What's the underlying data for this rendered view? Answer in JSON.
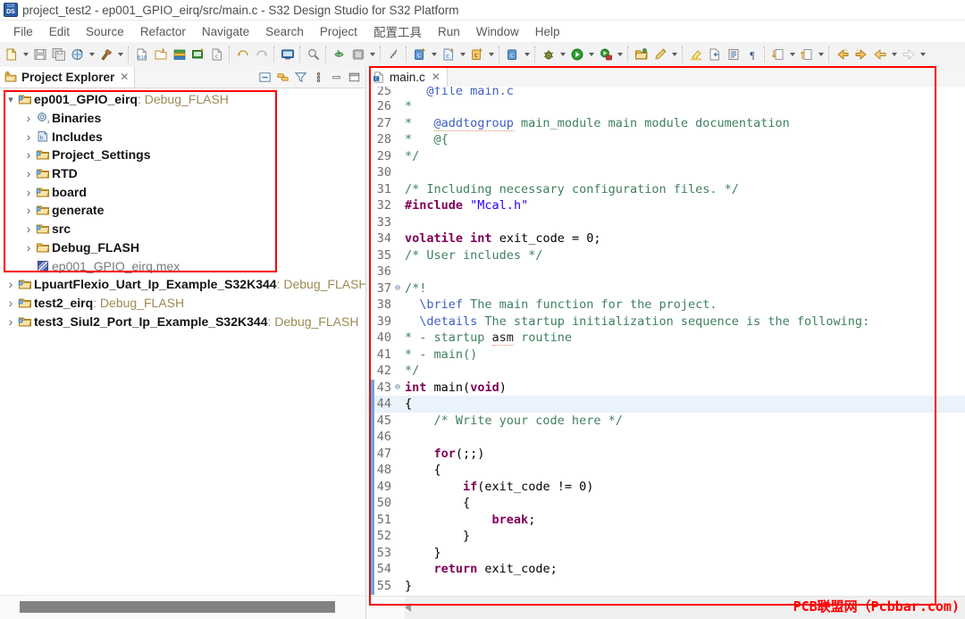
{
  "window": {
    "title": "project_test2 - ep001_GPIO_eirq/src/main.c - S32 Design Studio for S32 Platform",
    "app_icon": "s32ds-icon"
  },
  "menubar": {
    "items": [
      {
        "label": "File"
      },
      {
        "label": "Edit"
      },
      {
        "label": "Source"
      },
      {
        "label": "Refactor"
      },
      {
        "label": "Navigate"
      },
      {
        "label": "Search"
      },
      {
        "label": "Project"
      },
      {
        "label": "配置工具"
      },
      {
        "label": "Run"
      },
      {
        "label": "Window"
      },
      {
        "label": "Help"
      }
    ]
  },
  "toolbar": {
    "groups": [
      {
        "buttons": [
          {
            "icon": "new-file-icon",
            "dropdown": true
          },
          {
            "icon": "save-icon",
            "dropdown": false
          },
          {
            "icon": "save-all-icon",
            "dropdown": false
          },
          {
            "icon": "build-all-icon",
            "dropdown": true
          },
          {
            "icon": "hammer-build-icon",
            "dropdown": true
          }
        ]
      },
      {
        "buttons": [
          {
            "icon": "new-source-file-icon",
            "dropdown": false
          },
          {
            "icon": "new-folder-icon",
            "dropdown": false
          },
          {
            "icon": "new-class-icon",
            "dropdown": false
          },
          {
            "icon": "new-project-icon",
            "dropdown": false
          },
          {
            "icon": "new-header-icon",
            "dropdown": false
          }
        ]
      },
      {
        "buttons": [
          {
            "icon": "undo-icon",
            "dropdown": false
          },
          {
            "icon": "redo-icon",
            "dropdown": false
          }
        ]
      },
      {
        "buttons": [
          {
            "icon": "console-icon",
            "dropdown": false
          }
        ]
      },
      {
        "buttons": [
          {
            "icon": "search-disabled-icon",
            "dropdown": false
          }
        ]
      },
      {
        "buttons": [
          {
            "icon": "flash-programmer-icon",
            "dropdown": false
          },
          {
            "icon": "chip-icon",
            "dropdown": true
          }
        ]
      },
      {
        "buttons": [
          {
            "icon": "ruler-icon",
            "dropdown": false
          }
        ]
      },
      {
        "buttons": [
          {
            "icon": "new-config-icon",
            "dropdown": true
          },
          {
            "icon": "new-c-project-icon",
            "dropdown": true
          },
          {
            "icon": "new-c-file-icon",
            "dropdown": true
          }
        ]
      },
      {
        "buttons": [
          {
            "icon": "config-tools-icon",
            "dropdown": true
          }
        ]
      },
      {
        "buttons": [
          {
            "icon": "debug-bug-icon",
            "dropdown": true
          },
          {
            "icon": "run-icon",
            "dropdown": true
          },
          {
            "icon": "run-secure-icon",
            "dropdown": true
          }
        ]
      },
      {
        "buttons": [
          {
            "icon": "open-resource-icon",
            "dropdown": false
          },
          {
            "icon": "pencil-icon",
            "dropdown": true
          }
        ]
      },
      {
        "buttons": [
          {
            "icon": "highlighter-icon",
            "dropdown": false
          },
          {
            "icon": "export-icon",
            "dropdown": false
          },
          {
            "icon": "book-icon",
            "dropdown": false
          },
          {
            "icon": "pilcrow-icon",
            "dropdown": false
          }
        ]
      },
      {
        "buttons": [
          {
            "icon": "next-annotation-icon",
            "dropdown": true
          },
          {
            "icon": "previous-annotation-icon",
            "dropdown": true
          }
        ]
      },
      {
        "buttons": [
          {
            "icon": "back-history-icon",
            "dropdown": false
          },
          {
            "icon": "forward-history-icon",
            "dropdown": false
          },
          {
            "icon": "back-arrow-icon",
            "dropdown": true
          },
          {
            "icon": "forward-arrow-icon",
            "dropdown": true
          }
        ]
      }
    ]
  },
  "project_explorer": {
    "tab_label": "Project Explorer",
    "tab_icon": "project-explorer-icon",
    "close_glyph": "✕",
    "view_actions": [
      {
        "icon": "collapse-all-icon"
      },
      {
        "icon": "link-with-editor-icon"
      },
      {
        "icon": "filter-icon"
      },
      {
        "icon": "view-menu-icon"
      },
      {
        "icon": "minimize-icon"
      },
      {
        "icon": "maximize-icon"
      }
    ],
    "tree": [
      {
        "indent": 0,
        "twisty": "expanded",
        "icon": "project-open-icon",
        "label": "ep001_GPIO_eirq",
        "config": ": Debug_FLASH",
        "style": "bold"
      },
      {
        "indent": 1,
        "twisty": "collapsed",
        "icon": "binaries-icon",
        "label": "Binaries",
        "config": "",
        "style": "bold"
      },
      {
        "indent": 1,
        "twisty": "collapsed",
        "icon": "includes-icon",
        "label": "Includes",
        "config": "",
        "style": "bold"
      },
      {
        "indent": 1,
        "twisty": "collapsed",
        "icon": "source-folder-icon",
        "label": "Project_Settings",
        "config": "",
        "style": "bold"
      },
      {
        "indent": 1,
        "twisty": "collapsed",
        "icon": "source-folder-icon",
        "label": "RTD",
        "config": "",
        "style": "bold"
      },
      {
        "indent": 1,
        "twisty": "collapsed",
        "icon": "source-folder-icon",
        "label": "board",
        "config": "",
        "style": "bold"
      },
      {
        "indent": 1,
        "twisty": "collapsed",
        "icon": "source-folder-icon",
        "label": "generate",
        "config": "",
        "style": "bold"
      },
      {
        "indent": 1,
        "twisty": "collapsed",
        "icon": "source-folder-icon",
        "label": "src",
        "config": "",
        "style": "bold"
      },
      {
        "indent": 1,
        "twisty": "collapsed",
        "icon": "folder-icon",
        "label": "Debug_FLASH",
        "config": "",
        "style": "bold"
      },
      {
        "indent": 1,
        "twisty": "none",
        "icon": "mex-file-icon",
        "label": "ep001_GPIO_eirq.mex",
        "config": "",
        "style": "plain"
      },
      {
        "indent": 0,
        "twisty": "collapsed",
        "icon": "project-icon",
        "label": "LpuartFlexio_Uart_Ip_Example_S32K344",
        "config": ": Debug_FLASH",
        "style": "bold"
      },
      {
        "indent": 0,
        "twisty": "collapsed",
        "icon": "project-icon",
        "label": "test2_eirq",
        "config": ": Debug_FLASH",
        "style": "bold"
      },
      {
        "indent": 0,
        "twisty": "collapsed",
        "icon": "project-icon",
        "label": "test3_Siul2_Port_Ip_Example_S32K344",
        "config": ": Debug_FLASH",
        "style": "bold"
      }
    ]
  },
  "editor": {
    "tab": {
      "label": "main.c",
      "icon": "c-source-file-icon",
      "close_glyph": "✕"
    },
    "first_visible_line": 25,
    "current_line": 44,
    "changed_lines_from": 43,
    "changed_lines_to": 55,
    "lines": [
      {
        "n": 25,
        "fold": "",
        "clipped": true,
        "tokens": [
          {
            "t": "   ",
            "c": "plain"
          },
          {
            "t": "@file main.c",
            "c": "tag"
          }
        ]
      },
      {
        "n": 26,
        "fold": "",
        "tokens": [
          {
            "t": "*",
            "c": "cmt"
          }
        ]
      },
      {
        "n": 27,
        "fold": "",
        "tokens": [
          {
            "t": "*   ",
            "c": "cmt"
          },
          {
            "t": "@addtogroup",
            "c": "tagu"
          },
          {
            "t": " main_module main module documentation",
            "c": "cmt"
          }
        ]
      },
      {
        "n": 28,
        "fold": "",
        "tokens": [
          {
            "t": "*   @{",
            "c": "cmt"
          }
        ]
      },
      {
        "n": 29,
        "fold": "",
        "tokens": [
          {
            "t": "*/",
            "c": "cmt"
          }
        ]
      },
      {
        "n": 30,
        "fold": "",
        "tokens": [
          {
            "t": "",
            "c": "plain"
          }
        ]
      },
      {
        "n": 31,
        "fold": "",
        "tokens": [
          {
            "t": "/* Including necessary configuration files. */",
            "c": "cmt"
          }
        ]
      },
      {
        "n": 32,
        "fold": "",
        "tokens": [
          {
            "t": "#include",
            "c": "pp"
          },
          {
            "t": " ",
            "c": "plain"
          },
          {
            "t": "\"Mcal.h\"",
            "c": "str"
          }
        ]
      },
      {
        "n": 33,
        "fold": "",
        "tokens": [
          {
            "t": "",
            "c": "plain"
          }
        ]
      },
      {
        "n": 34,
        "fold": "",
        "tokens": [
          {
            "t": "volatile",
            "c": "kw"
          },
          {
            "t": " ",
            "c": "plain"
          },
          {
            "t": "int",
            "c": "kw"
          },
          {
            "t": " exit_code = 0;",
            "c": "plain"
          }
        ]
      },
      {
        "n": 35,
        "fold": "",
        "tokens": [
          {
            "t": "/* User includes */",
            "c": "cmt"
          }
        ]
      },
      {
        "n": 36,
        "fold": "",
        "tokens": [
          {
            "t": "",
            "c": "plain"
          }
        ]
      },
      {
        "n": 37,
        "fold": "⊖",
        "tokens": [
          {
            "t": "/*!",
            "c": "cmt"
          }
        ]
      },
      {
        "n": 38,
        "fold": "",
        "tokens": [
          {
            "t": "  ",
            "c": "cmt"
          },
          {
            "t": "\\brief",
            "c": "tag"
          },
          {
            "t": " The main function for the project.",
            "c": "cmt"
          }
        ]
      },
      {
        "n": 39,
        "fold": "",
        "tokens": [
          {
            "t": "  ",
            "c": "cmt"
          },
          {
            "t": "\\details",
            "c": "tag"
          },
          {
            "t": " The startup initialization sequence is the following:",
            "c": "cmt"
          }
        ]
      },
      {
        "n": 40,
        "fold": "",
        "tokens": [
          {
            "t": "* - startup ",
            "c": "cmt"
          },
          {
            "t": "asm",
            "c": "spell"
          },
          {
            "t": " routine",
            "c": "cmt"
          }
        ]
      },
      {
        "n": 41,
        "fold": "",
        "tokens": [
          {
            "t": "* - main()",
            "c": "cmt"
          }
        ]
      },
      {
        "n": 42,
        "fold": "",
        "tokens": [
          {
            "t": "*/",
            "c": "cmt"
          }
        ]
      },
      {
        "n": 43,
        "fold": "⊖",
        "tokens": [
          {
            "t": "int",
            "c": "kw"
          },
          {
            "t": " ",
            "c": "plain"
          },
          {
            "t": "main",
            "c": "plain"
          },
          {
            "t": "(",
            "c": "plain"
          },
          {
            "t": "void",
            "c": "kw"
          },
          {
            "t": ")",
            "c": "plain"
          }
        ]
      },
      {
        "n": 44,
        "fold": "",
        "tokens": [
          {
            "t": "{",
            "c": "plain"
          }
        ]
      },
      {
        "n": 45,
        "fold": "",
        "tokens": [
          {
            "t": "    /* Write your code here */",
            "c": "cmt"
          }
        ]
      },
      {
        "n": 46,
        "fold": "",
        "tokens": [
          {
            "t": "",
            "c": "plain"
          }
        ]
      },
      {
        "n": 47,
        "fold": "",
        "tokens": [
          {
            "t": "    ",
            "c": "plain"
          },
          {
            "t": "for",
            "c": "kw"
          },
          {
            "t": "(;;)",
            "c": "plain"
          }
        ]
      },
      {
        "n": 48,
        "fold": "",
        "tokens": [
          {
            "t": "    {",
            "c": "plain"
          }
        ]
      },
      {
        "n": 49,
        "fold": "",
        "tokens": [
          {
            "t": "        ",
            "c": "plain"
          },
          {
            "t": "if",
            "c": "kw"
          },
          {
            "t": "(exit_code != 0)",
            "c": "plain"
          }
        ]
      },
      {
        "n": 50,
        "fold": "",
        "tokens": [
          {
            "t": "        {",
            "c": "plain"
          }
        ]
      },
      {
        "n": 51,
        "fold": "",
        "tokens": [
          {
            "t": "            ",
            "c": "plain"
          },
          {
            "t": "break",
            "c": "kw"
          },
          {
            "t": ";",
            "c": "plain"
          }
        ]
      },
      {
        "n": 52,
        "fold": "",
        "tokens": [
          {
            "t": "        }",
            "c": "plain"
          }
        ]
      },
      {
        "n": 53,
        "fold": "",
        "tokens": [
          {
            "t": "    }",
            "c": "plain"
          }
        ]
      },
      {
        "n": 54,
        "fold": "",
        "tokens": [
          {
            "t": "    ",
            "c": "plain"
          },
          {
            "t": "return",
            "c": "kw"
          },
          {
            "t": " exit_code;",
            "c": "plain"
          }
        ]
      },
      {
        "n": 55,
        "fold": "",
        "tokens": [
          {
            "t": "}",
            "c": "plain"
          }
        ]
      }
    ]
  },
  "watermark": {
    "text": "PCB联盟网（Pcbbar.com)",
    "color": "#ff0000"
  },
  "annotations": {
    "highlight_color": "#ff0000"
  }
}
